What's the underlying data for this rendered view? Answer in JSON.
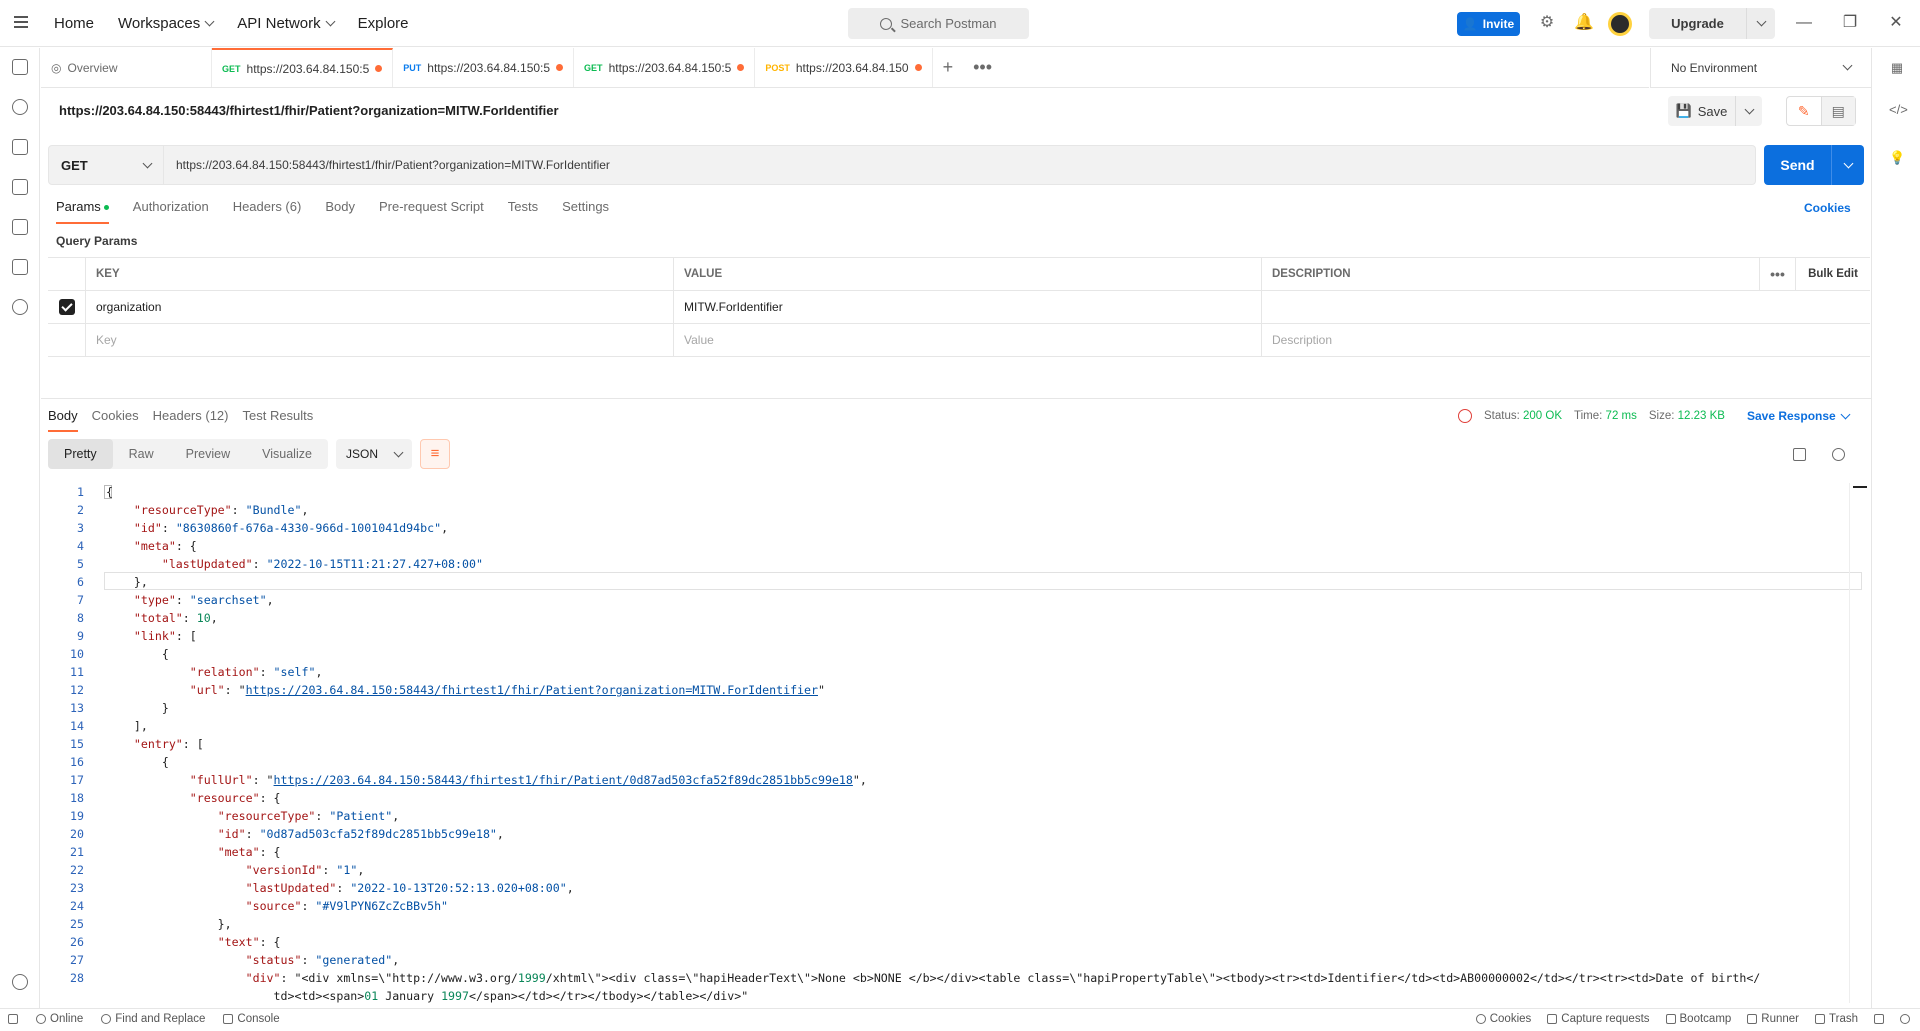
{
  "nav": {
    "home": "Home",
    "workspaces": "Workspaces",
    "api_network": "API Network",
    "explore": "Explore"
  },
  "search": {
    "placeholder": "Search Postman"
  },
  "header": {
    "invite": "Invite",
    "upgrade": "Upgrade"
  },
  "tabs": [
    {
      "label": "Overview"
    },
    {
      "method": "GET",
      "label": "https://203.64.84.150:5",
      "active": true
    },
    {
      "method": "PUT",
      "label": "https://203.64.84.150:5"
    },
    {
      "method": "GET",
      "label": "https://203.64.84.150:5"
    },
    {
      "method": "POST",
      "label": "https://203.64.84.150"
    }
  ],
  "environment": "No Environment",
  "request": {
    "title": "https://203.64.84.150:58443/fhirtest1/fhir/Patient?organization=MITW.ForIdentifier",
    "save": "Save",
    "method": "GET",
    "url": "https://203.64.84.150:58443/fhirtest1/fhir/Patient?organization=MITW.ForIdentifier",
    "send": "Send"
  },
  "request_tabs": [
    "Params",
    "Authorization",
    "Headers (6)",
    "Body",
    "Pre-request Script",
    "Tests",
    "Settings"
  ],
  "cookies_link": "Cookies",
  "query_params": {
    "title": "Query Params",
    "headers": {
      "key": "KEY",
      "value": "VALUE",
      "description": "DESCRIPTION",
      "bulk_edit": "Bulk Edit"
    },
    "rows": [
      {
        "key": "organization",
        "value": "MITW.ForIdentifier",
        "description": ""
      }
    ],
    "placeholders": {
      "key": "Key",
      "value": "Value",
      "description": "Description"
    }
  },
  "response_tabs": [
    "Body",
    "Cookies",
    "Headers (12)",
    "Test Results"
  ],
  "response_status": {
    "status_label": "Status:",
    "status": "200 OK",
    "time_label": "Time:",
    "time": "72 ms",
    "size_label": "Size:",
    "size": "12.23 KB",
    "save_response": "Save Response"
  },
  "view_modes": [
    "Pretty",
    "Raw",
    "Preview",
    "Visualize"
  ],
  "format": "JSON",
  "code_lines": [
    "{",
    "    \"resourceType\": \"Bundle\",",
    "    \"id\": \"8630860f-676a-4330-966d-1001041d94bc\",",
    "    \"meta\": {",
    "        \"lastUpdated\": \"2022-10-15T11:21:27.427+08:00\"",
    "    },",
    "    \"type\": \"searchset\",",
    "    \"total\": 10,",
    "    \"link\": [",
    "        {",
    "            \"relation\": \"self\",",
    "            \"url\": \"https://203.64.84.150:58443/fhirtest1/fhir/Patient?organization=MITW.ForIdentifier\"",
    "        }",
    "    ],",
    "    \"entry\": [",
    "        {",
    "            \"fullUrl\": \"https://203.64.84.150:58443/fhirtest1/fhir/Patient/0d87ad503cfa52f89dc2851bb5c99e18\",",
    "            \"resource\": {",
    "                \"resourceType\": \"Patient\",",
    "                \"id\": \"0d87ad503cfa52f89dc2851bb5c99e18\",",
    "                \"meta\": {",
    "                    \"versionId\": \"1\",",
    "                    \"lastUpdated\": \"2022-10-13T20:52:13.020+08:00\",",
    "                    \"source\": \"#V9lPYN6ZcZcBBv5h\"",
    "                },",
    "                \"text\": {",
    "                    \"status\": \"generated\",",
    "                    \"div\": \"<div xmlns=\\\"http://www.w3.org/1999/xhtml\\\"><div class=\\\"hapiHeaderText\\\">None <b>NONE </b></div><table class=\\\"hapiPropertyTable\\\"><tbody><tr><td>Identifier</td><td>AB00000002</td></tr><tr><td>Date of birth</",
    "                        td><td><span>01 January 1997</span></td></tr></tbody></table></div>\""
  ],
  "footer": {
    "left": [
      "Online",
      "Find and Replace",
      "Console"
    ],
    "right": [
      "Cookies",
      "Capture requests",
      "Bootcamp",
      "Runner",
      "Trash"
    ]
  },
  "colors": {
    "accent": "#ff6c37",
    "primary": "#0c6fde",
    "success": "#0cbb52"
  }
}
